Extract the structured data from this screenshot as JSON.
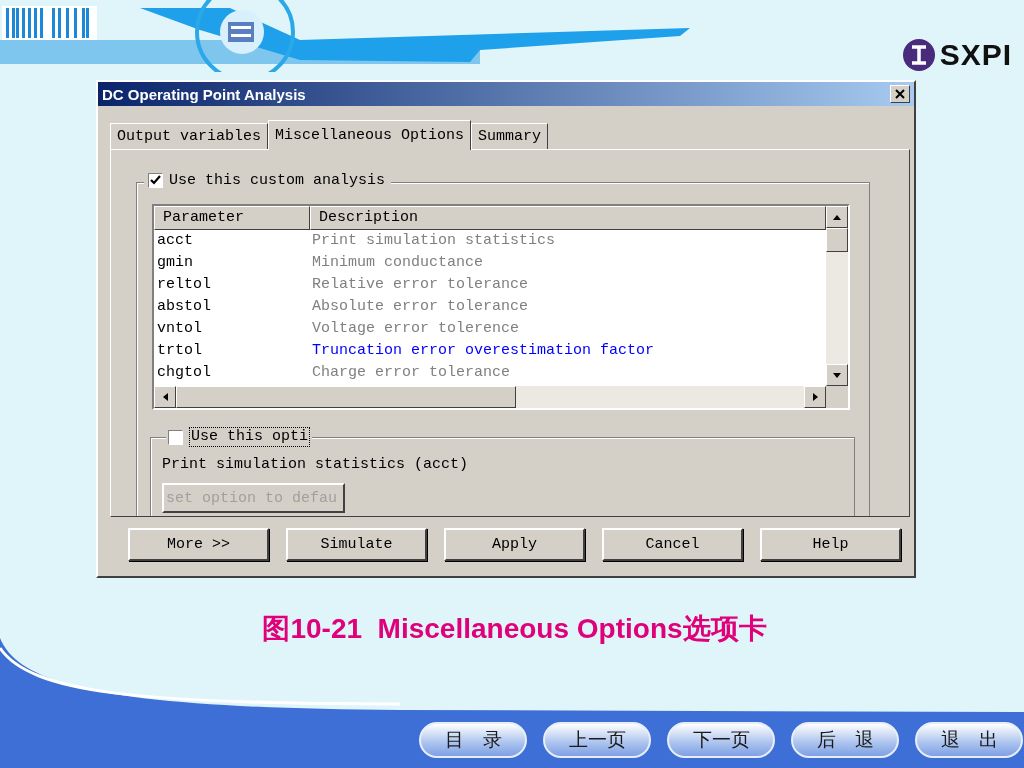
{
  "header": {
    "logo_text": "SXPI"
  },
  "dialog": {
    "title": "DC Operating Point Analysis",
    "tabs": [
      {
        "label": "Output variables",
        "selected": false
      },
      {
        "label": "Miscellaneous Options",
        "selected": true
      },
      {
        "label": "Summary",
        "selected": false
      }
    ],
    "custom_analysis": {
      "label": "Use this custom analysis",
      "checked": true
    },
    "table": {
      "columns": [
        "Parameter",
        "Description"
      ],
      "rows": [
        {
          "parameter": "acct",
          "description": "Print simulation statistics",
          "highlighted": false
        },
        {
          "parameter": "gmin",
          "description": "Minimum conductance",
          "highlighted": false
        },
        {
          "parameter": "reltol",
          "description": "Relative error tolerance",
          "highlighted": false
        },
        {
          "parameter": "abstol",
          "description": "Absolute error tolerance",
          "highlighted": false
        },
        {
          "parameter": "vntol",
          "description": "Voltage error tolerence",
          "highlighted": false
        },
        {
          "parameter": "trtol",
          "description": "Truncation error overestimation factor",
          "highlighted": true
        },
        {
          "parameter": "chgtol",
          "description": "Charge error tolerance",
          "highlighted": false
        }
      ]
    },
    "option": {
      "label": "Use this opti",
      "checked": false,
      "description": "Print simulation statistics (acct)",
      "button": "set option to defau",
      "button_disabled": true
    },
    "buttons": [
      "More >>",
      "Simulate",
      "Apply",
      "Cancel",
      "Help"
    ]
  },
  "caption": "图10-21  Miscellaneous Options选项卡",
  "nav_buttons": [
    "目　录",
    "上一页",
    "下一页",
    "后　退",
    "退　出"
  ]
}
